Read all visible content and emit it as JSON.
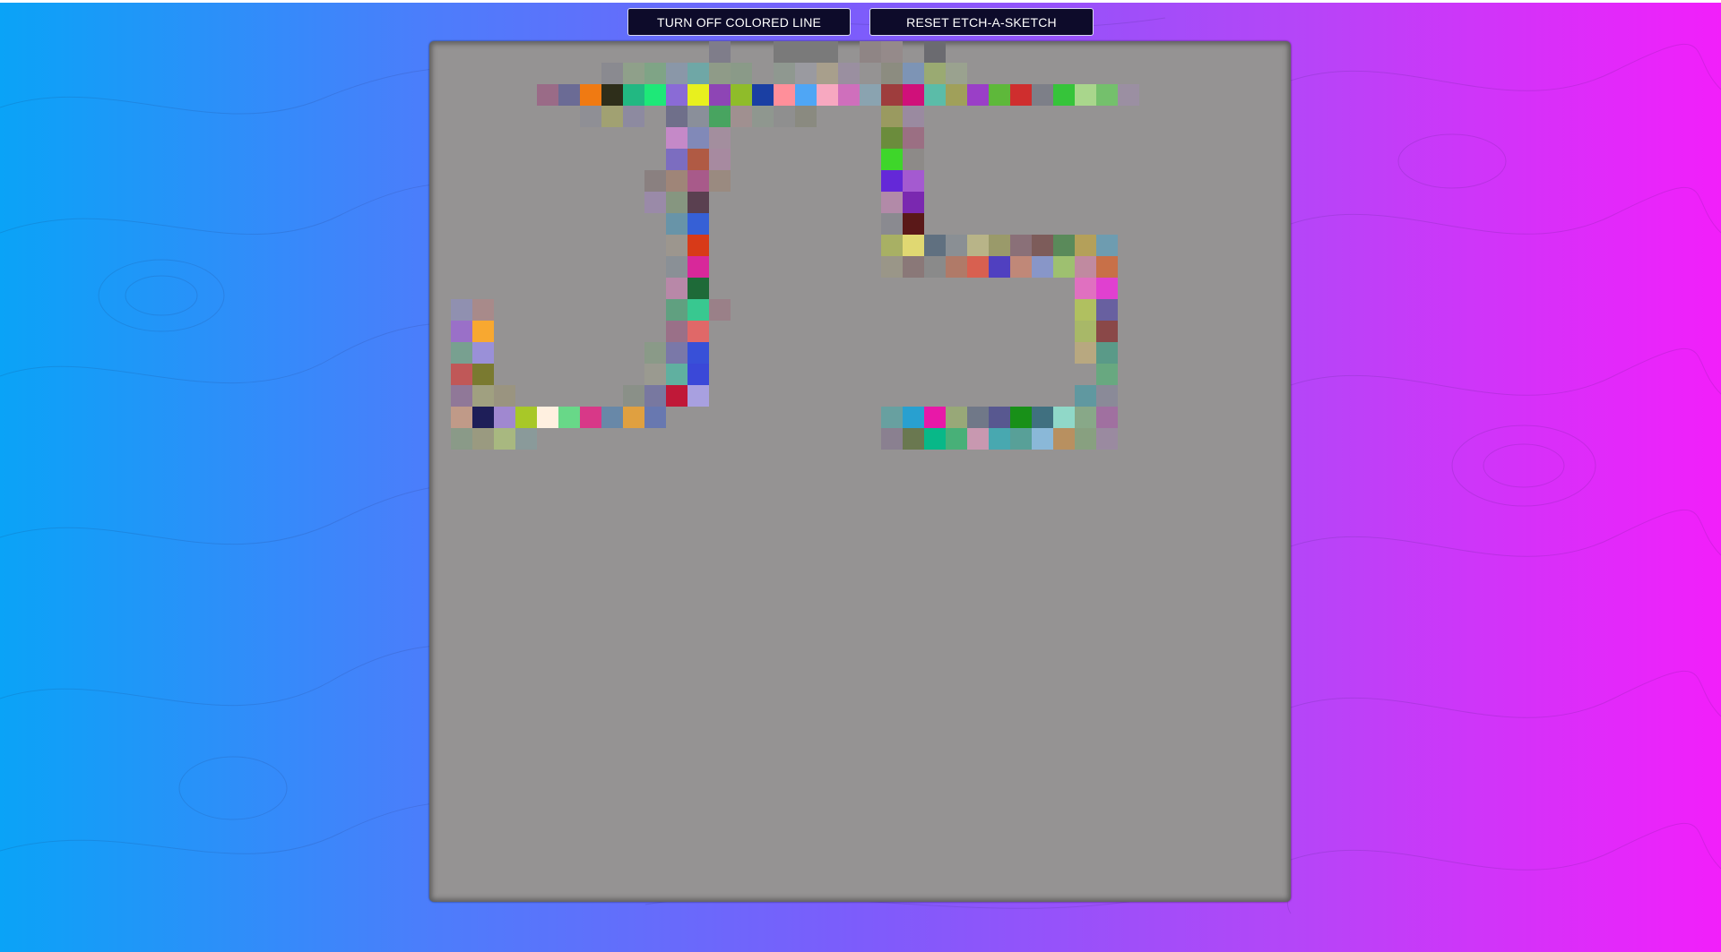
{
  "toolbar": {
    "toggle_label": "TURN OFF COLORED LINE",
    "reset_label": "RESET ETCH-A-SKETCH"
  },
  "colors": {
    "board_background": "#959393",
    "button_background": "#0d0b2a",
    "gradient_left": "#0aa3f7",
    "gradient_right": "#f21ffa"
  },
  "sketch": {
    "cells": [
      [
        0,
        13,
        "#7f7d8a"
      ],
      [
        0,
        16,
        "#7a7a7a"
      ],
      [
        0,
        17,
        "#7a7a7a"
      ],
      [
        0,
        18,
        "#7a7a7a"
      ],
      [
        0,
        20,
        "#8f8585"
      ],
      [
        0,
        21,
        "#958a8a"
      ],
      [
        0,
        23,
        "#6b6b70"
      ],
      [
        1,
        8,
        "#8a8a90"
      ],
      [
        1,
        9,
        "#8fa08a"
      ],
      [
        1,
        10,
        "#7fa486"
      ],
      [
        1,
        11,
        "#8a97a8"
      ],
      [
        1,
        12,
        "#6fa7a6"
      ],
      [
        1,
        13,
        "#8f9b88"
      ],
      [
        1,
        14,
        "#8a9a88"
      ],
      [
        1,
        16,
        "#8f9890"
      ],
      [
        1,
        17,
        "#9a9aa0"
      ],
      [
        1,
        18,
        "#a89f8c"
      ],
      [
        1,
        19,
        "#9a8fa0"
      ],
      [
        1,
        21,
        "#8c8c80"
      ],
      [
        1,
        22,
        "#7d94b5"
      ],
      [
        1,
        23,
        "#9aaa72"
      ],
      [
        1,
        24,
        "#9aa28f"
      ],
      [
        2,
        5,
        "#9a6b87"
      ],
      [
        2,
        6,
        "#6b6b95"
      ],
      [
        2,
        7,
        "#f07a12"
      ],
      [
        2,
        8,
        "#2e2e1a"
      ],
      [
        2,
        9,
        "#22b882"
      ],
      [
        2,
        10,
        "#1ee878"
      ],
      [
        2,
        11,
        "#8a6bd6"
      ],
      [
        2,
        12,
        "#e8f01e"
      ],
      [
        2,
        13,
        "#8e45b5"
      ],
      [
        2,
        14,
        "#8fbc2a"
      ],
      [
        2,
        15,
        "#1a3fa3"
      ],
      [
        2,
        16,
        "#ff8f9a"
      ],
      [
        2,
        17,
        "#4fa6f5"
      ],
      [
        2,
        18,
        "#f7a8c0"
      ],
      [
        2,
        19,
        "#cf6fbc"
      ],
      [
        2,
        20,
        "#8aa3b0"
      ],
      [
        2,
        21,
        "#9e3d3d"
      ],
      [
        2,
        22,
        "#d0107a"
      ],
      [
        2,
        23,
        "#5bbca8"
      ],
      [
        2,
        24,
        "#a0a05a"
      ],
      [
        2,
        25,
        "#9a3fc7"
      ],
      [
        2,
        26,
        "#5eb83a"
      ],
      [
        2,
        27,
        "#cf2e2e"
      ],
      [
        2,
        28,
        "#7d7f88"
      ],
      [
        2,
        29,
        "#36c43a"
      ],
      [
        2,
        30,
        "#a9d68c"
      ],
      [
        2,
        31,
        "#74c06c"
      ],
      [
        2,
        32,
        "#9b8fa2"
      ],
      [
        3,
        7,
        "#8f8f95"
      ],
      [
        3,
        8,
        "#a1a172"
      ],
      [
        3,
        9,
        "#8d8aa0"
      ],
      [
        3,
        11,
        "#6f6f8a"
      ],
      [
        3,
        12,
        "#8a8f9a"
      ],
      [
        3,
        13,
        "#48a460"
      ],
      [
        3,
        14,
        "#a09090"
      ],
      [
        3,
        15,
        "#8f978f"
      ],
      [
        3,
        16,
        "#8f8f8f"
      ],
      [
        3,
        17,
        "#8a8a80"
      ],
      [
        3,
        21,
        "#9a9a60"
      ],
      [
        3,
        22,
        "#9a8aa0"
      ],
      [
        4,
        11,
        "#c589c8"
      ],
      [
        4,
        12,
        "#8189b8"
      ],
      [
        4,
        13,
        "#a38e9e"
      ],
      [
        4,
        21,
        "#6b8c3c"
      ],
      [
        4,
        22,
        "#9b6f83"
      ],
      [
        5,
        11,
        "#7c6dc0"
      ],
      [
        5,
        12,
        "#b05a44"
      ],
      [
        5,
        13,
        "#a78aa0"
      ],
      [
        5,
        21,
        "#3ed62a"
      ],
      [
        5,
        22,
        "#8d8a88"
      ],
      [
        6,
        10,
        "#8a8080"
      ],
      [
        6,
        11,
        "#9f8578"
      ],
      [
        6,
        12,
        "#a85a8a"
      ],
      [
        6,
        13,
        "#9a8a80"
      ],
      [
        6,
        21,
        "#6428d8"
      ],
      [
        6,
        22,
        "#a45ad0"
      ],
      [
        7,
        10,
        "#9a8aa8"
      ],
      [
        7,
        11,
        "#869680"
      ],
      [
        7,
        12,
        "#5a4050"
      ],
      [
        7,
        21,
        "#b28aa8"
      ],
      [
        7,
        22,
        "#7a28b0"
      ],
      [
        8,
        11,
        "#6894a8"
      ],
      [
        8,
        12,
        "#3660d6"
      ],
      [
        8,
        21,
        "#8a8a90"
      ],
      [
        8,
        22,
        "#5a1818"
      ],
      [
        9,
        11,
        "#9c968e"
      ],
      [
        9,
        12,
        "#d83a18"
      ],
      [
        9,
        21,
        "#a8b064"
      ],
      [
        9,
        22,
        "#e0d872"
      ],
      [
        9,
        23,
        "#607080"
      ],
      [
        9,
        24,
        "#8a8f94"
      ],
      [
        9,
        25,
        "#b8b488"
      ],
      [
        9,
        26,
        "#9a9a6a"
      ],
      [
        9,
        27,
        "#8a7078"
      ],
      [
        9,
        28,
        "#7d5c5a"
      ],
      [
        9,
        29,
        "#5a8a5a"
      ],
      [
        9,
        30,
        "#b4a05a"
      ],
      [
        9,
        31,
        "#6e9cb0"
      ],
      [
        10,
        11,
        "#8a9096"
      ],
      [
        10,
        12,
        "#d8289a"
      ],
      [
        10,
        21,
        "#9a9688"
      ],
      [
        10,
        22,
        "#8a7878"
      ],
      [
        10,
        23,
        "#8a8a8a"
      ],
      [
        10,
        24,
        "#b07a68"
      ],
      [
        10,
        25,
        "#d86050"
      ],
      [
        10,
        26,
        "#5040c0"
      ],
      [
        10,
        27,
        "#c08878"
      ],
      [
        10,
        28,
        "#8896c8"
      ],
      [
        10,
        29,
        "#9ec070"
      ],
      [
        10,
        30,
        "#c08aa0"
      ],
      [
        10,
        31,
        "#c87048"
      ],
      [
        11,
        11,
        "#b888a8"
      ],
      [
        11,
        12,
        "#1e6a38"
      ],
      [
        11,
        30,
        "#e070c0"
      ],
      [
        11,
        31,
        "#e040d0"
      ],
      [
        12,
        1,
        "#9090b0"
      ],
      [
        12,
        2,
        "#a88a8a"
      ],
      [
        12,
        11,
        "#60a080"
      ],
      [
        12,
        12,
        "#38c890"
      ],
      [
        12,
        13,
        "#9a8088"
      ],
      [
        12,
        30,
        "#b0c060"
      ],
      [
        12,
        31,
        "#6860a0"
      ],
      [
        13,
        1,
        "#9a70c8"
      ],
      [
        13,
        2,
        "#f8a830"
      ],
      [
        13,
        11,
        "#9a7088"
      ],
      [
        13,
        12,
        "#e06868"
      ],
      [
        13,
        30,
        "#a8b868"
      ],
      [
        13,
        31,
        "#8a4848"
      ],
      [
        14,
        1,
        "#78a090"
      ],
      [
        14,
        2,
        "#9a90d8"
      ],
      [
        14,
        10,
        "#8a9a88"
      ],
      [
        14,
        11,
        "#7a78a8"
      ],
      [
        14,
        12,
        "#3850d8"
      ],
      [
        14,
        30,
        "#b8a880"
      ],
      [
        14,
        31,
        "#5a9a88"
      ],
      [
        15,
        1,
        "#c05858"
      ],
      [
        15,
        2,
        "#7a7a30"
      ],
      [
        15,
        10,
        "#9a9a90"
      ],
      [
        15,
        11,
        "#60b0a0"
      ],
      [
        15,
        12,
        "#3a48d8"
      ],
      [
        15,
        31,
        "#68a880"
      ],
      [
        16,
        1,
        "#907898"
      ],
      [
        16,
        2,
        "#a0a080"
      ],
      [
        16,
        3,
        "#9a9480"
      ],
      [
        16,
        9,
        "#8a9088"
      ],
      [
        16,
        10,
        "#7878a0"
      ],
      [
        16,
        11,
        "#c01838"
      ],
      [
        16,
        12,
        "#a8a0e0"
      ],
      [
        16,
        30,
        "#6098a0"
      ],
      [
        16,
        31,
        "#8a8a98"
      ],
      [
        17,
        1,
        "#c09a88"
      ],
      [
        17,
        2,
        "#1e1e58"
      ],
      [
        17,
        3,
        "#a088d0"
      ],
      [
        17,
        4,
        "#a8c828"
      ],
      [
        17,
        5,
        "#fff0e0"
      ],
      [
        17,
        6,
        "#68d888"
      ],
      [
        17,
        7,
        "#d83888"
      ],
      [
        17,
        8,
        "#6888a8"
      ],
      [
        17,
        9,
        "#e0a040"
      ],
      [
        17,
        10,
        "#6878b0"
      ],
      [
        17,
        21,
        "#68a0a0"
      ],
      [
        17,
        22,
        "#28a0d0"
      ],
      [
        17,
        23,
        "#e818a8"
      ],
      [
        17,
        24,
        "#98a878"
      ],
      [
        17,
        25,
        "#707888"
      ],
      [
        17,
        26,
        "#585890"
      ],
      [
        17,
        27,
        "#189018"
      ],
      [
        17,
        28,
        "#407080"
      ],
      [
        17,
        29,
        "#90d8c8"
      ],
      [
        17,
        30,
        "#88a888"
      ],
      [
        17,
        31,
        "#a070a0"
      ],
      [
        18,
        1,
        "#8a9a88"
      ],
      [
        18,
        2,
        "#9a9a80"
      ],
      [
        18,
        3,
        "#a8b880"
      ],
      [
        18,
        4,
        "#8a9a9a"
      ],
      [
        18,
        21,
        "#8a8090"
      ],
      [
        18,
        22,
        "#6a7850"
      ],
      [
        18,
        23,
        "#08b888"
      ],
      [
        18,
        24,
        "#48b078"
      ],
      [
        18,
        25,
        "#c898b0"
      ],
      [
        18,
        26,
        "#48a8b0"
      ],
      [
        18,
        27,
        "#58a098"
      ],
      [
        18,
        28,
        "#8ab8d8"
      ],
      [
        18,
        29,
        "#b89060"
      ],
      [
        18,
        30,
        "#88a080"
      ],
      [
        18,
        31,
        "#9a8aa0"
      ]
    ]
  }
}
